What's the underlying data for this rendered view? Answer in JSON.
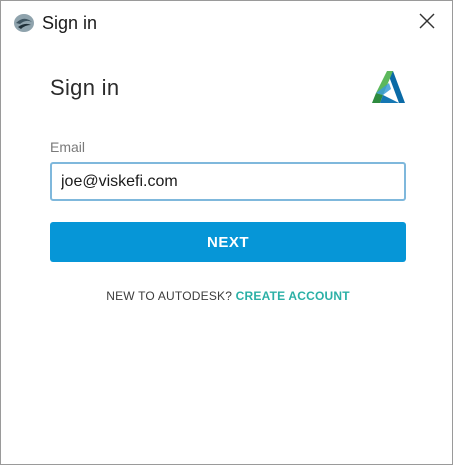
{
  "window": {
    "title": "Sign in"
  },
  "form": {
    "heading": "Sign in",
    "email_label": "Email",
    "email_value": "joe@viskefi.com",
    "next_label": "NEXT",
    "signup_prompt": "NEW TO AUTODESK?",
    "create_account_label": "CREATE ACCOUNT"
  },
  "icons": {
    "app": "app-logo-icon",
    "close": "close-icon",
    "brand": "autodesk-logo-icon"
  },
  "colors": {
    "accent": "#0696d7",
    "link": "#2bb0a6",
    "input_border": "#7fb8dc"
  }
}
